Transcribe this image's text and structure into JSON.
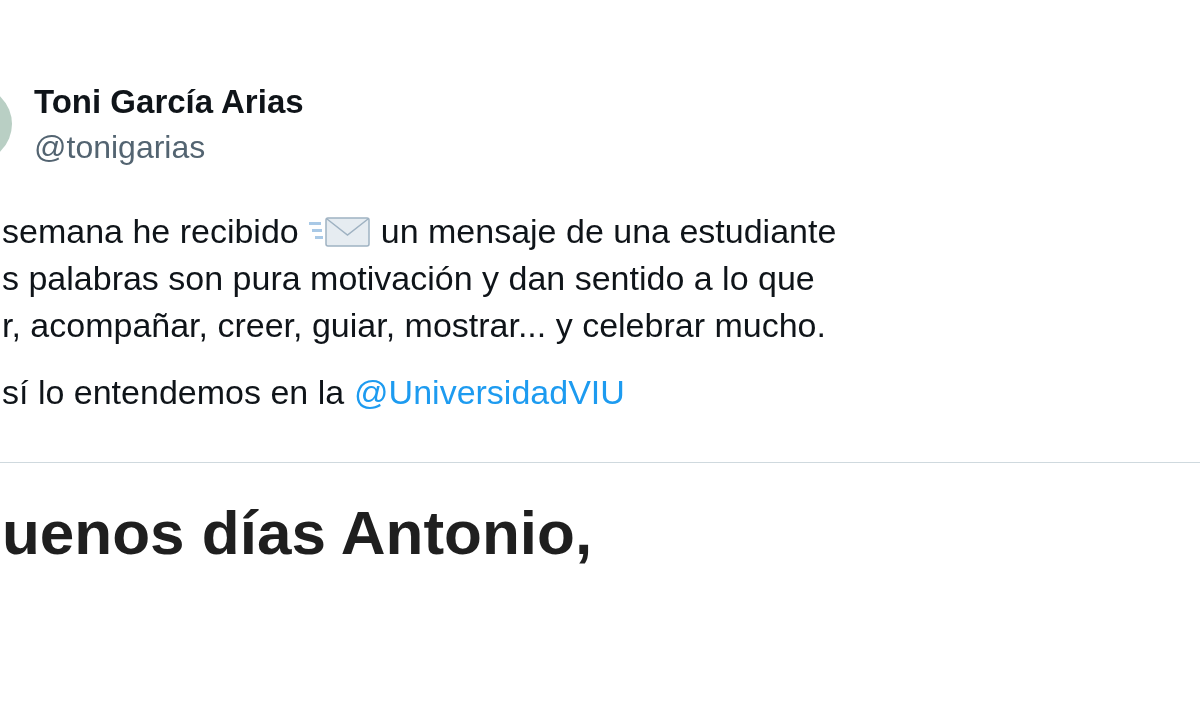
{
  "author": {
    "name": "Toni García Arias",
    "handle": "@tonigarias"
  },
  "paragraphs": [
    [
      {
        "kind": "emoji",
        "before": "semana he recibido",
        "after": "un mensaje de una estudiante"
      },
      {
        "kind": "plain",
        "text": "s palabras son pura motivación y dan sentido a lo que"
      },
      {
        "kind": "plain",
        "text": "r, acompañar, creer, guiar, mostrar... y celebrar mucho."
      }
    ],
    [
      {
        "kind": "mention",
        "text": "sí lo entendemos en la",
        "mention": "@UniversidadVIU"
      }
    ]
  ],
  "attached_image": {
    "text": "uenos días Antonio,"
  }
}
